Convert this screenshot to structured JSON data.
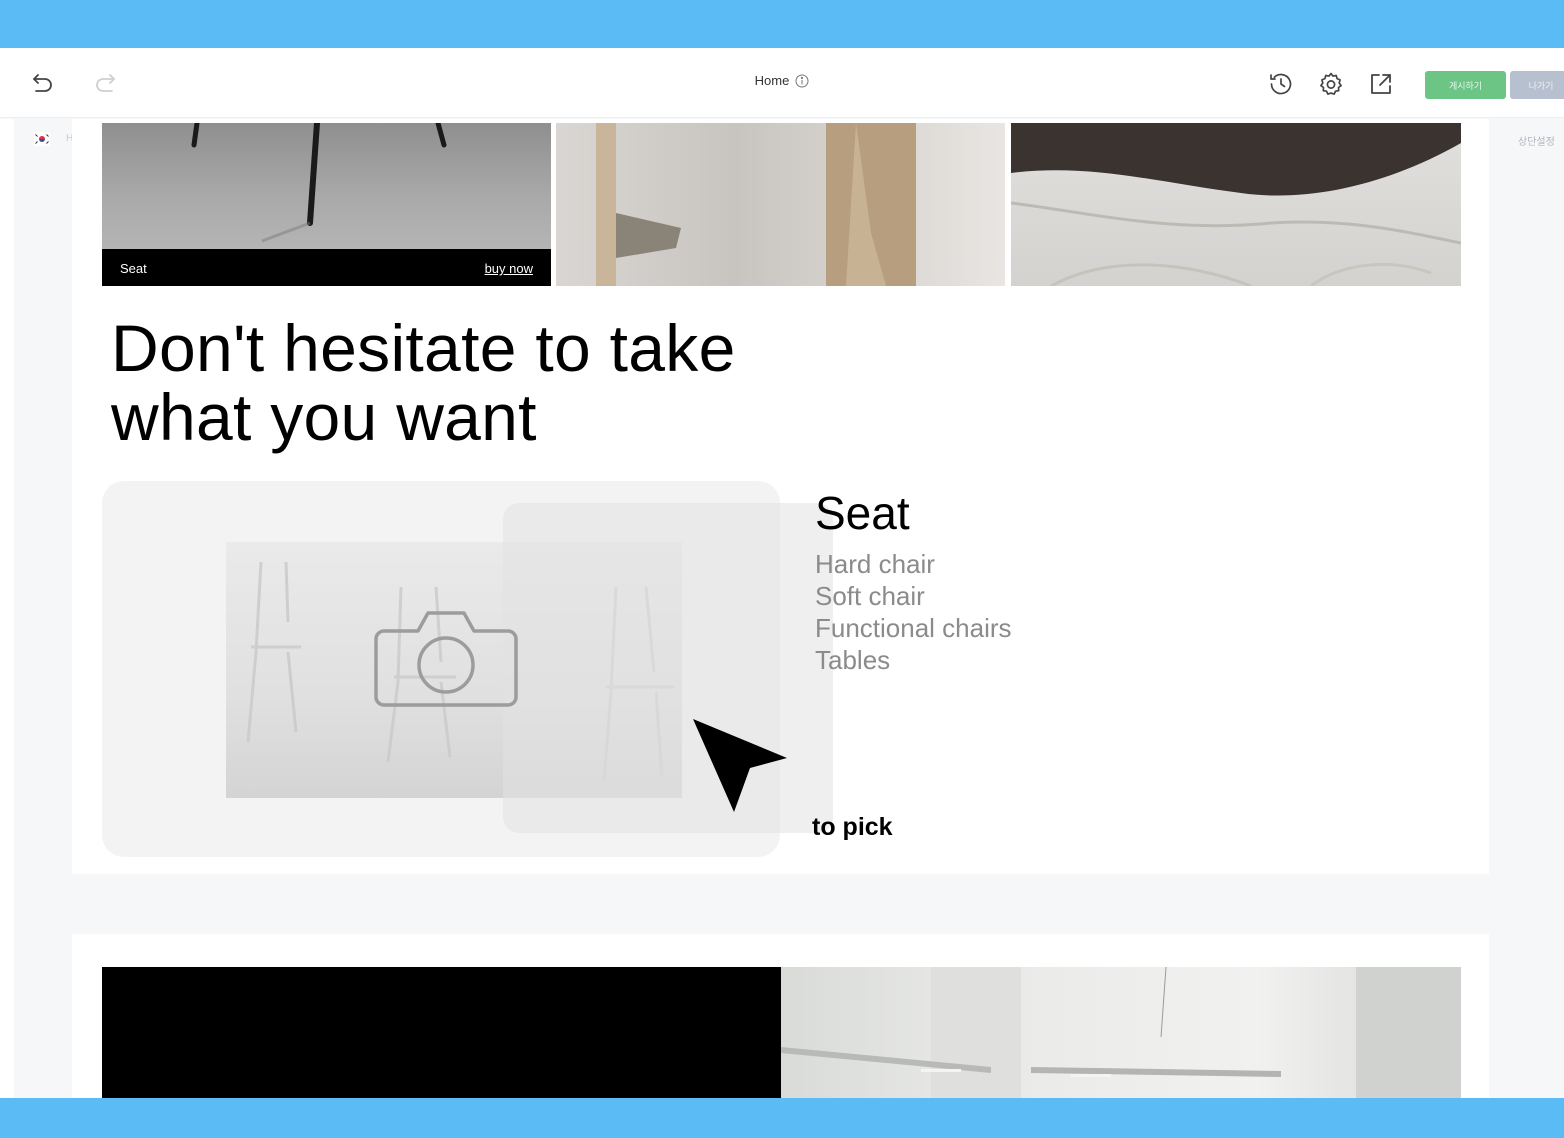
{
  "toolbar": {
    "page_title": "Home",
    "icons": [
      "undo-icon",
      "redo-icon",
      "info-icon",
      "history-icon",
      "gear-icon",
      "external-link-icon"
    ],
    "publish_label": "게시하기",
    "exit_label": "나가기"
  },
  "left_panel": {
    "language_label": "H"
  },
  "right_panel": {
    "label": "상단설정"
  },
  "gallery": {
    "tiles": [
      {
        "caption": "Seat",
        "action": "buy now"
      },
      {
        "caption": "",
        "action": ""
      },
      {
        "caption": "",
        "action": ""
      }
    ]
  },
  "headline": {
    "line1": "Don't hesitate to take",
    "line2": "what you want"
  },
  "category": {
    "title": "Seat",
    "items": [
      "Hard chair",
      "Soft chair",
      "Functional chairs",
      "Tables"
    ]
  },
  "hint": {
    "text": "to pick"
  },
  "colors": {
    "frame": "#5bbcf5",
    "publish": "#6cc485",
    "exit": "#b7c0ce",
    "muted_text": "#8b8b8b"
  }
}
